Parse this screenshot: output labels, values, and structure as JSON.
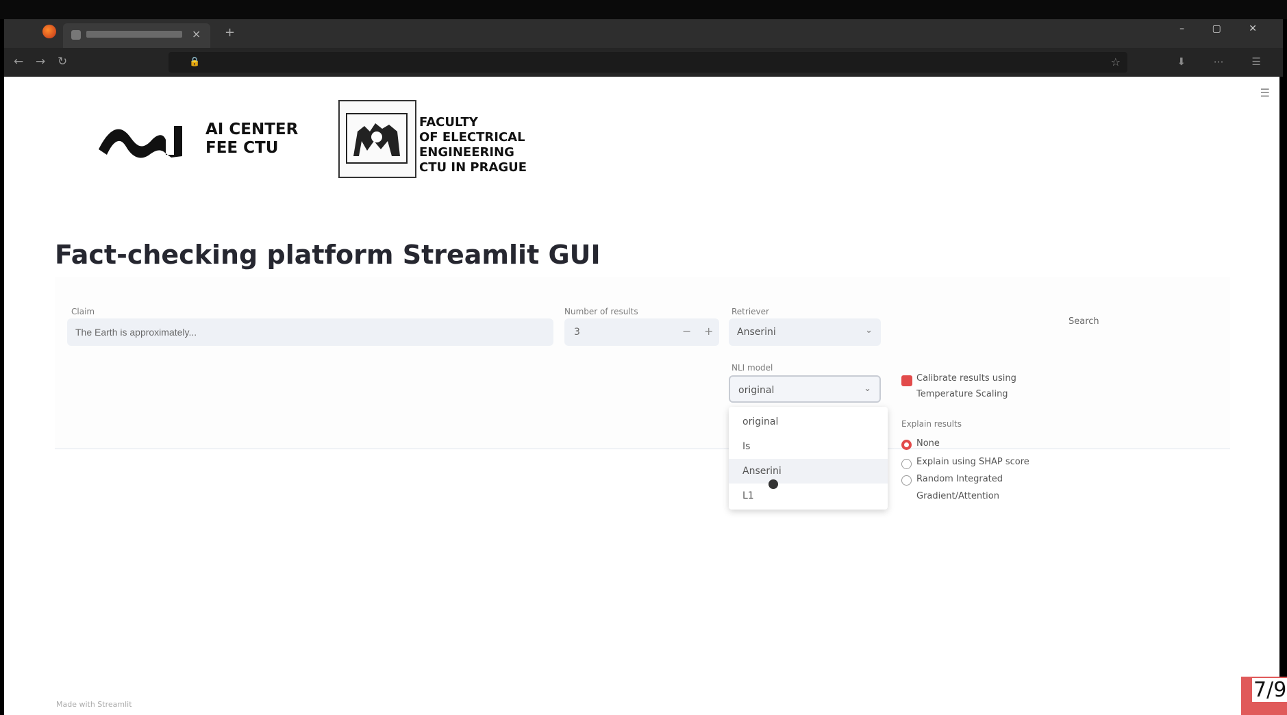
{
  "browser": {
    "tab_title": "",
    "url": "",
    "new_tab_glyph": "+",
    "tab_close_glyph": "×",
    "back_glyph": "←",
    "forward_glyph": "→",
    "reload_glyph": "↻",
    "bookmark_glyph": "☆",
    "window_controls": "– ▢ ✕",
    "toolbar_icons": "⬇ ⋯ ☰",
    "lock_glyph": "🔒"
  },
  "logos": {
    "ai_center_line1": "AI CENTER",
    "ai_center_line2": "FEE CTU",
    "faculty_line1": "FACULTY",
    "faculty_line2": "OF ELECTRICAL",
    "faculty_line3": "ENGINEERING",
    "faculty_line4": "CTU IN PRAGUE"
  },
  "page": {
    "title": "Fact-checking platform Streamlit GUI",
    "menu_glyph": "☰"
  },
  "form": {
    "claim": {
      "label": "Claim",
      "value": "The Earth is approximately..."
    },
    "num_evidence": {
      "label": "Number of results",
      "value": "3",
      "minus": "−",
      "plus": "+"
    },
    "retriever": {
      "label": "Retriever",
      "value": "Anserini",
      "chevron": "⌄"
    },
    "nli": {
      "label": "NLI model",
      "value": "original",
      "chevron": "⌄",
      "options": [
        "original",
        "Is",
        "Anserini",
        "L1"
      ],
      "highlighted_index": 2
    },
    "calibrate": {
      "label_line1": "Calibrate results using",
      "label_line2": "Temperature Scaling",
      "checked": true
    },
    "explain": {
      "label": "Explain results",
      "options": [
        "None",
        "Explain using SHAP score",
        "Random Integrated",
        "Gradient/Attention"
      ],
      "selected_index": 0
    },
    "search_button": "Search"
  },
  "footer": {
    "note": "Made with Streamlit"
  },
  "slide_counter": "7/9",
  "colors": {
    "accent": "#e24b4b",
    "page_bg": "#ffffff",
    "input_bg": "#eef1f6",
    "title": "#262730"
  }
}
